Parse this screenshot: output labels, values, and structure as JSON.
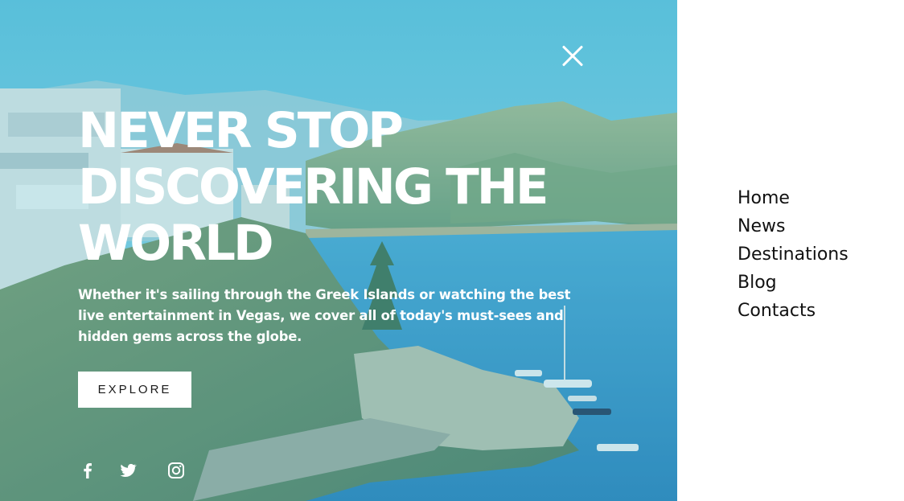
{
  "hero": {
    "headline_lines": [
      "NEVER STOP",
      "DISCOVERING THE",
      "WORLD"
    ],
    "subtext": "Whether it's sailing through the Greek Islands or watching the best live entertainment in Vegas, we cover all of today's must-sees and hidden gems across the globe.",
    "cta_label": "EXPLORE",
    "close_icon": "close-icon",
    "social": [
      "facebook-icon",
      "twitter-icon",
      "instagram-icon"
    ]
  },
  "menu": {
    "items": [
      "Home",
      "News",
      "Destinations",
      "Blog",
      "Contacts"
    ]
  },
  "colors": {
    "overlay_tint": "#46b9d7",
    "sea": "#2f8fc4",
    "hills": "#8fae7a",
    "text_light": "#ffffff",
    "menu_text": "#111111",
    "button_bg": "#ffffff"
  }
}
